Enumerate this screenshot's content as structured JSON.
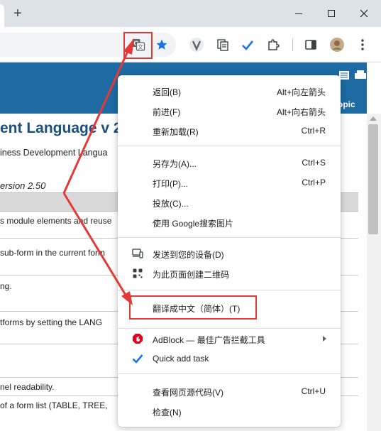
{
  "browser": {
    "new_tab_glyph": "+",
    "tab_close_glyph": "✕",
    "window_controls": [
      "minimize",
      "maximize",
      "close"
    ]
  },
  "toolbar": {
    "icons": [
      "translate-icon",
      "star-icon",
      "extension-v-icon",
      "copy-extension-icon",
      "checkmark-extension-icon",
      "extensions-puzzle-icon",
      "side-panel-icon",
      "profile-avatar",
      "menu-kebab-icon"
    ],
    "star_color": "#1a73e8"
  },
  "page": {
    "banner_color": "#1e6aa3",
    "banner_text": "opic",
    "title": "ent Language  v 2",
    "subtitle": "iness Development Langua",
    "version": "ersion 2.50",
    "rows": [
      "s module elements and reuse",
      "sub-form in the current form",
      "ng.",
      "tforms by setting the LANG",
      "nel readability.",
      "of a form list (TABLE, TREE,"
    ]
  },
  "context_menu": {
    "groups": [
      [
        {
          "label": "返回(B)",
          "shortcut": "Alt+向左箭头"
        },
        {
          "label": "前进(F)",
          "shortcut": "Alt+向右箭头"
        },
        {
          "label": "重新加载(R)",
          "shortcut": "Ctrl+R"
        }
      ],
      [
        {
          "label": "另存为(A)...",
          "shortcut": "Ctrl+S"
        },
        {
          "label": "打印(P)...",
          "shortcut": "Ctrl+P"
        },
        {
          "label": "投放(C)..."
        },
        {
          "label": "使用 Google搜索图片"
        }
      ],
      [
        {
          "label": "发送到您的设备(D)",
          "icon": "device-icon"
        },
        {
          "label": "为此页面创建二维码",
          "icon": "qr-code-icon"
        }
      ],
      [
        {
          "label": "翻译成中文（简体）(T)"
        }
      ],
      [
        {
          "label": "AdBlock — 最佳广告拦截工具",
          "icon": "adblock-icon",
          "submenu": true
        },
        {
          "label": "Quick add task",
          "icon": "checkmark-icon"
        }
      ],
      [
        {
          "label": "查看网页源代码(V)",
          "shortcut": "Ctrl+U"
        },
        {
          "label": "检查(N)"
        }
      ]
    ]
  },
  "colors": {
    "annotation_red": "#e53935",
    "adblock_red": "#e3001b",
    "check_blue": "#1a73e8"
  }
}
